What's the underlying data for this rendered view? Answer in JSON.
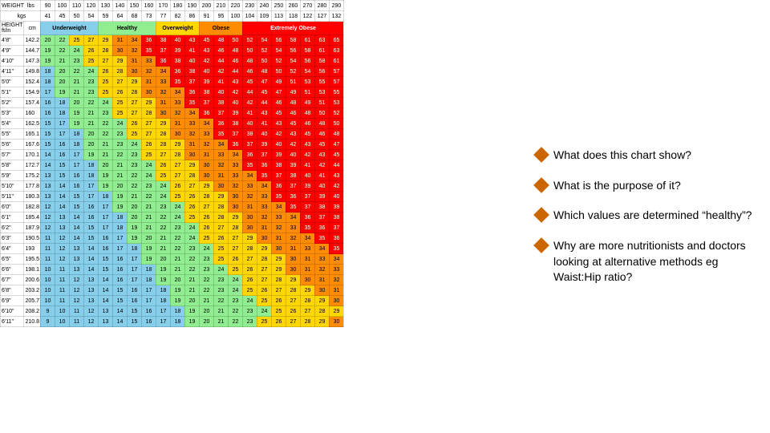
{
  "chart": {
    "weight_label": "WEIGHT",
    "lbs_label": "lbs",
    "kgs_label": "kgs",
    "height_label": "HEIGHT",
    "ftin_label": "ft/in",
    "cm_label": "cm",
    "categories": [
      {
        "label": "Underweight",
        "class": "cat-underweight"
      },
      {
        "label": "Healthy",
        "class": "cat-healthy"
      },
      {
        "label": "Overweight",
        "class": "cat-overweight"
      },
      {
        "label": "Obese",
        "class": "cat-obese"
      },
      {
        "label": "Extremely\nObese",
        "class": "cat-ext"
      }
    ]
  },
  "questions": [
    {
      "id": "q1",
      "text": "What does this chart show?"
    },
    {
      "id": "q2",
      "text": "What is the purpose of it?"
    },
    {
      "id": "q3",
      "text": "Which values are determined “healthy”?"
    },
    {
      "id": "q4",
      "text": "Why are more nutritionists and doctors looking at alternative methods eg Waist:Hip ratio?"
    }
  ]
}
